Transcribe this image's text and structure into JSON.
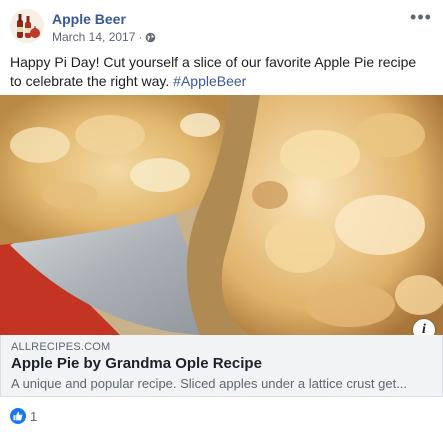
{
  "post": {
    "page_name": "Apple Beer",
    "date": "March 14, 2017",
    "dot": "·",
    "privacy_icon": "globe-icon",
    "more_icon": "ellipsis-icon",
    "text": "Happy Pi Day! Cut yourself a slice of our favorite Apple Pie recipe to celebrate the right way. ",
    "hashtag": "#AppleBeer"
  },
  "link": {
    "domain": "ALLRECIPES.COM",
    "title": "Apple Pie by Grandma Ople Recipe",
    "description": "A unique and popular recipe. Sliced apples under a lattice crust get...",
    "info_icon": "i"
  },
  "reactions": {
    "icon": "like-icon",
    "count": "1"
  },
  "colors": {
    "link_blue": "#385898",
    "secondary_text": "#606770",
    "like_blue": "#1877f2",
    "link_box_bg": "#f2f3f5"
  }
}
